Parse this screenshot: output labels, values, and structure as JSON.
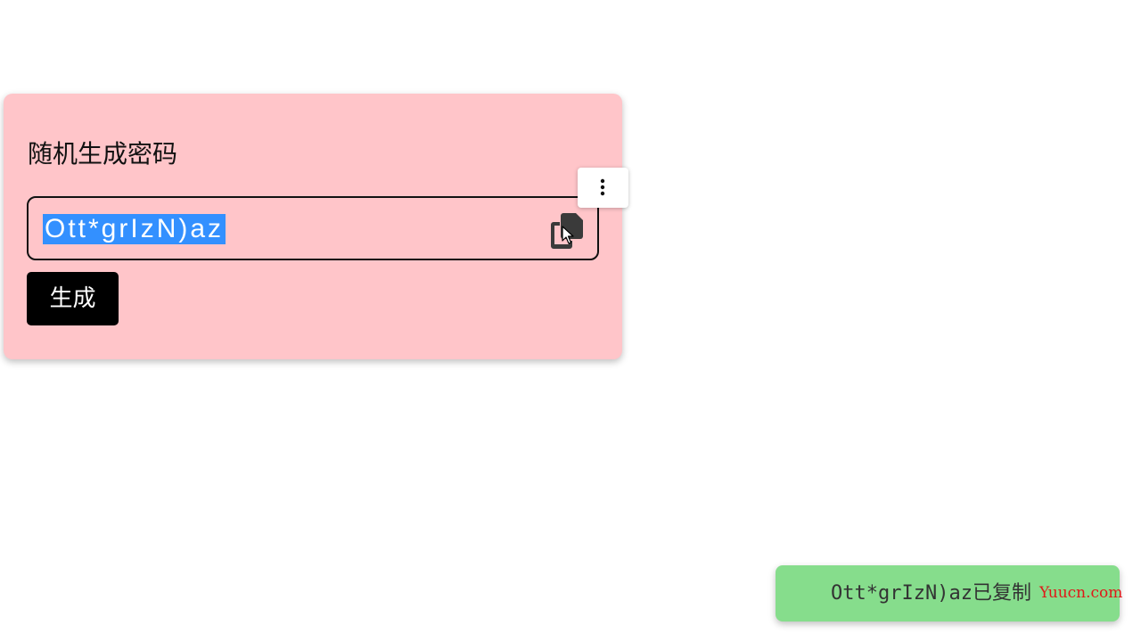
{
  "card": {
    "title": "随机生成密码",
    "password": "Ott*grIzN)az",
    "generate_label": "生成",
    "background": "#ffc5c9"
  },
  "icons": {
    "copy": "copy-icon",
    "more": "more-vertical-icon",
    "cursor": "mouse-pointer-icon"
  },
  "toast": {
    "message": "Ott*grIzN)az已复制",
    "background": "#86dd8c"
  },
  "watermark": "Yuucn.com",
  "colors": {
    "selection": "#3390ff",
    "button": "#000000",
    "watermark": "#e01818"
  }
}
